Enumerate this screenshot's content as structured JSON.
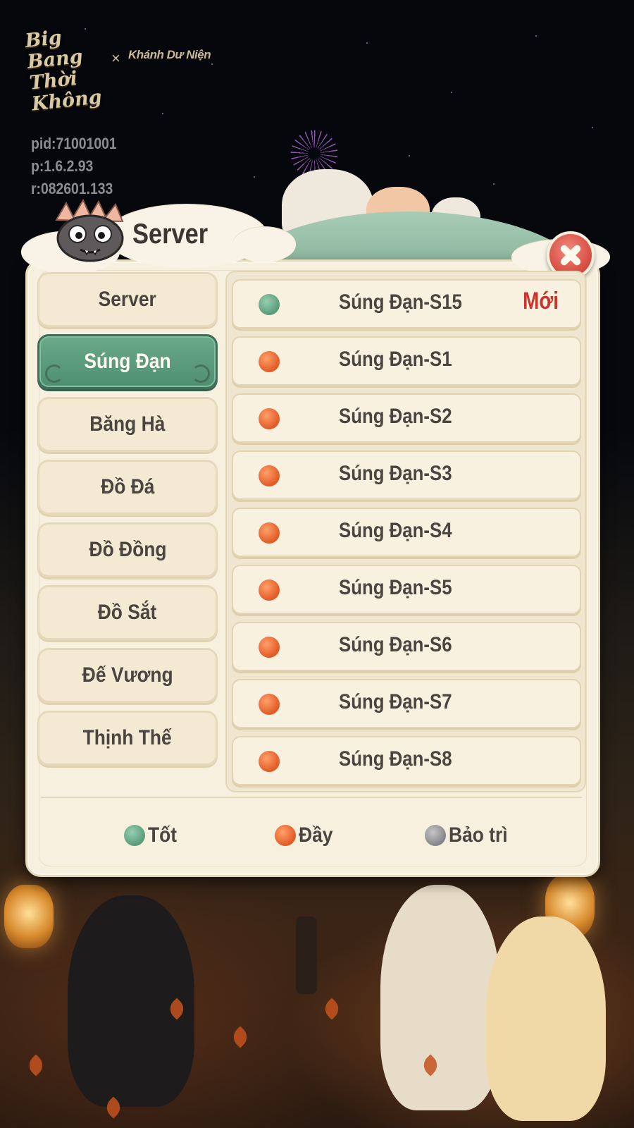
{
  "app": {
    "logo_text": "Big Bang Thời Không",
    "collab_text": "Khánh Dư Niện",
    "collab_separator": "×"
  },
  "debug_info": {
    "pid": "pid:71001001",
    "p": "p:1.6.2.93",
    "r": "r:082601.133"
  },
  "dialog": {
    "title": "Server",
    "close_icon": "close-x-icon"
  },
  "tabs": [
    {
      "label": "Server",
      "active": false
    },
    {
      "label": "Súng Đạn",
      "active": true
    },
    {
      "label": "Băng Hà",
      "active": false
    },
    {
      "label": "Đồ Đá",
      "active": false
    },
    {
      "label": "Đồ Đồng",
      "active": false
    },
    {
      "label": "Đồ Sắt",
      "active": false
    },
    {
      "label": "Đế Vương",
      "active": false
    },
    {
      "label": "Thịnh Thế",
      "active": false
    }
  ],
  "servers": [
    {
      "name": "Súng Đạn-S15",
      "status": "good",
      "tag": "Mới"
    },
    {
      "name": "Súng Đạn-S1",
      "status": "full",
      "tag": ""
    },
    {
      "name": "Súng Đạn-S2",
      "status": "full",
      "tag": ""
    },
    {
      "name": "Súng Đạn-S3",
      "status": "full",
      "tag": ""
    },
    {
      "name": "Súng Đạn-S4",
      "status": "full",
      "tag": ""
    },
    {
      "name": "Súng Đạn-S5",
      "status": "full",
      "tag": ""
    },
    {
      "name": "Súng Đạn-S6",
      "status": "full",
      "tag": ""
    },
    {
      "name": "Súng Đạn-S7",
      "status": "full",
      "tag": ""
    },
    {
      "name": "Súng Đạn-S8",
      "status": "full",
      "tag": ""
    }
  ],
  "legend": {
    "good": "Tốt",
    "full": "Đầy",
    "maintenance": "Bảo trì"
  },
  "colors": {
    "status_good": "#6aa98a",
    "status_full": "#e8642c",
    "status_maintenance": "#9a9a9e",
    "active_tab": "#5a9a7b",
    "new_tag": "#c8352c",
    "panel_bg": "#f7f0de"
  }
}
